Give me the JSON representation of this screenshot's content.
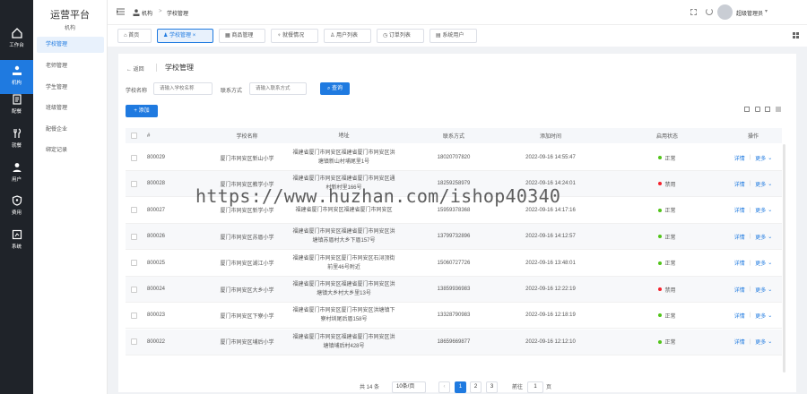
{
  "rail": [
    {
      "label": "工作台",
      "icon": "home-icon"
    },
    {
      "label": "机构",
      "icon": "org-icon"
    },
    {
      "label": "配餐",
      "icon": "menu-doc-icon"
    },
    {
      "label": "就餐",
      "icon": "fork-icon"
    },
    {
      "label": "用户",
      "icon": "user-icon"
    },
    {
      "label": "费用",
      "icon": "shield-icon"
    },
    {
      "label": "系统",
      "icon": "system-icon"
    }
  ],
  "brand": {
    "title": "运营平台",
    "subtitle": "机构"
  },
  "sidebar": [
    {
      "label": "学校管理"
    },
    {
      "label": "老师管理"
    },
    {
      "label": "学生管理"
    },
    {
      "label": "班级管理"
    },
    {
      "label": "配餐企业"
    },
    {
      "label": "绑定记录"
    }
  ],
  "header": {
    "breadcrumb_root": "机构",
    "breadcrumb_sep": ">",
    "breadcrumb_current": "学校管理",
    "user_name": "超级管理员"
  },
  "tabs": [
    {
      "label": "首页"
    },
    {
      "label": "学校管理"
    },
    {
      "label": "商品管理"
    },
    {
      "label": "就餐情况"
    },
    {
      "label": "用户列表"
    },
    {
      "label": "订单列表"
    },
    {
      "label": "系统用户"
    }
  ],
  "page": {
    "back": "返回",
    "title": "学校管理"
  },
  "filters": {
    "school_label": "学校名称",
    "school_placeholder": "请输入学校名称",
    "contact_label": "联系方式",
    "contact_placeholder": "请输入联系方式",
    "search_button": "查询",
    "add_button": "添加"
  },
  "table": {
    "headers": {
      "id": "#",
      "name": "学校名称",
      "address": "地址",
      "phone": "联系方式",
      "time": "添加时间",
      "status": "启用状态",
      "op": "操作"
    },
    "op_detail": "详情",
    "op_sep": "|",
    "op_more": "更多",
    "rows": [
      {
        "id": "800029",
        "name": "厦门市同安区新山小学",
        "address": "福建省厦门市同安区福建省厦门市同安区洪塘镇新山村埔尾里1号",
        "phone": "18020707820",
        "time": "2022-09-16 14:55:47",
        "status": "正常",
        "status_color": "#52c41a"
      },
      {
        "id": "800028",
        "name": "厦门市同安区教学小学",
        "address": "福建省厦门市同安区福建省厦门市同安区通村新村里166号",
        "phone": "18259258979",
        "time": "2022-09-16 14:24:01",
        "status": "禁用",
        "status_color": "#f5222d"
      },
      {
        "id": "800027",
        "name": "厦门市同安区新学小学",
        "address": "福建省厦门市同安区福建省厦门市同安区",
        "phone": "15959378368",
        "time": "2022-09-16 14:17:16",
        "status": "正常",
        "status_color": "#52c41a"
      },
      {
        "id": "800026",
        "name": "厦门市同安区苏厝小学",
        "address": "福建省厦门市同安区福建省厦门市同安区洪塘镇苏厝村大乡下厝157号",
        "phone": "13799732896",
        "time": "2022-09-16 14:12:57",
        "status": "正常",
        "status_color": "#52c41a"
      },
      {
        "id": "800025",
        "name": "厦门市同安区湖江小学",
        "address": "福建省厦门市同安区厦门市同安区石浔顶街前里46号附近",
        "phone": "15060727726",
        "time": "2022-09-16 13:48:01",
        "status": "正常",
        "status_color": "#52c41a"
      },
      {
        "id": "800024",
        "name": "厦门市同安区大乡小学",
        "address": "福建省厦门市同安区福建省厦门市同安区洪塘镇大乡村大乡里13号",
        "phone": "13859936983",
        "time": "2022-09-16 12:22:19",
        "status": "禁用",
        "status_color": "#f5222d"
      },
      {
        "id": "800023",
        "name": "厦门市同安区下寮小学",
        "address": "福建省厦门市同安区厦门市同安区洪塘镇下寮村圳尾后厝158号",
        "phone": "13328790983",
        "time": "2022-09-16 12:18:19",
        "status": "正常",
        "status_color": "#52c41a"
      },
      {
        "id": "800022",
        "name": "厦门市同安区埔后小学",
        "address": "福建省厦门市同安区福建省厦门市同安区洪塘镇埔后村428号",
        "phone": "18659669877",
        "time": "2022-09-16 12:12:10",
        "status": "正常",
        "status_color": "#52c41a"
      }
    ]
  },
  "pagination": {
    "total": "共 14 条",
    "page_size": "10条/页",
    "pages": [
      "1",
      "2",
      "3"
    ],
    "goto_label": "前往",
    "goto_value": "1",
    "page_unit": "页"
  },
  "watermark": "https://www.huzhan.com/ishop40340",
  "colors": {
    "primary": "#1f7ae0",
    "rail_bg": "#1f2329",
    "ok": "#52c41a",
    "disabled": "#f5222d"
  }
}
